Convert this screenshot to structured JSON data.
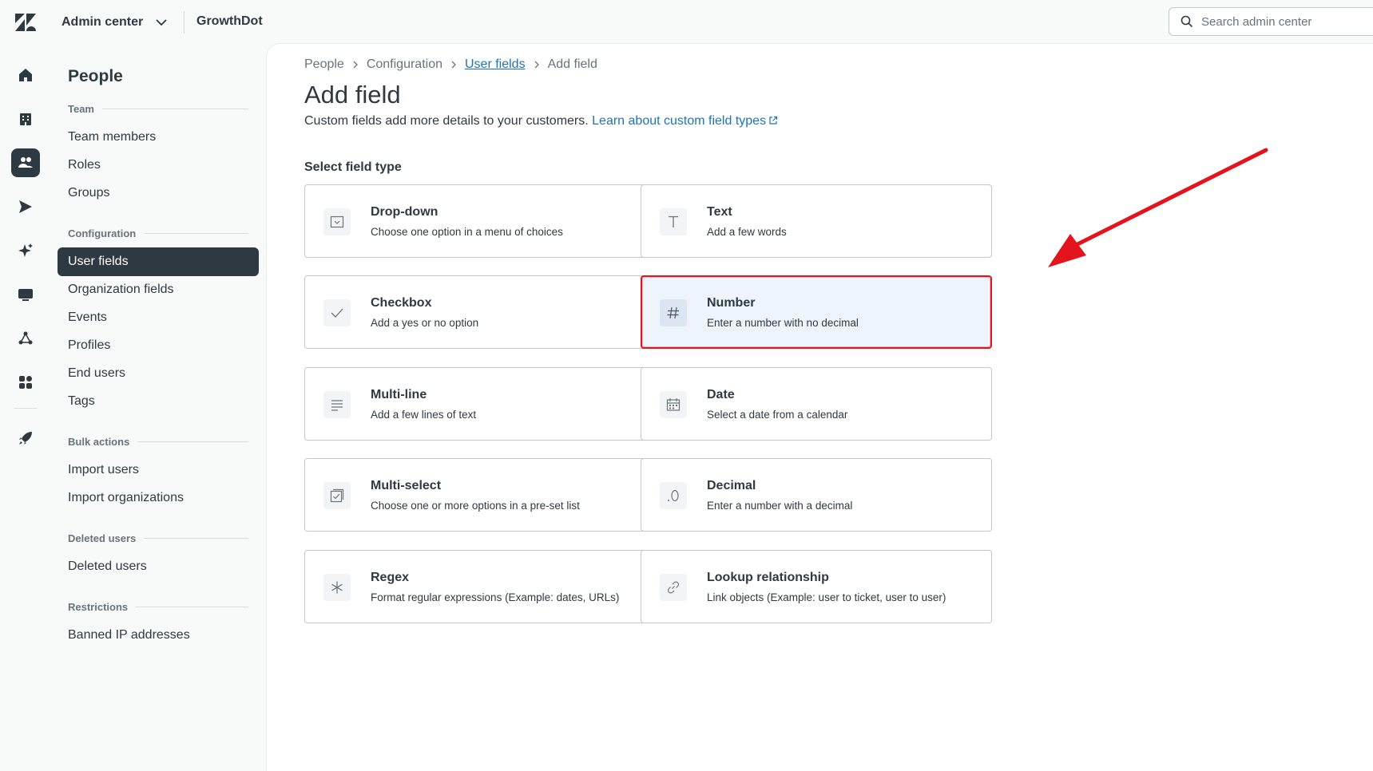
{
  "topbar": {
    "product_label": "Admin center",
    "account_name": "GrowthDot",
    "search_placeholder": "Search admin center"
  },
  "rail": {
    "items": [
      {
        "icon": "home-icon",
        "active": false
      },
      {
        "icon": "building-icon",
        "active": false
      },
      {
        "icon": "people-icon",
        "active": true
      },
      {
        "icon": "channels-icon",
        "active": false
      },
      {
        "icon": "sparkle-icon",
        "active": false
      },
      {
        "icon": "workspaces-icon",
        "active": false
      },
      {
        "icon": "objects-icon",
        "active": false
      },
      {
        "icon": "apps-icon",
        "active": false
      },
      {
        "icon": "rocket-icon",
        "active": false
      }
    ]
  },
  "subnav": {
    "title": "People",
    "sections": [
      {
        "label": "Team",
        "items": [
          "Team members",
          "Roles",
          "Groups"
        ]
      },
      {
        "label": "Configuration",
        "items": [
          "User fields",
          "Organization fields",
          "Events",
          "Profiles",
          "End users",
          "Tags"
        ]
      },
      {
        "label": "Bulk actions",
        "items": [
          "Import users",
          "Import organizations"
        ]
      },
      {
        "label": "Deleted users",
        "items": [
          "Deleted users"
        ]
      },
      {
        "label": "Restrictions",
        "items": [
          "Banned IP addresses"
        ]
      }
    ],
    "active_item": "User fields"
  },
  "breadcrumb": {
    "items": [
      {
        "label": "People",
        "link": false
      },
      {
        "label": "Configuration",
        "link": false
      },
      {
        "label": "User fields",
        "link": true
      },
      {
        "label": "Add field",
        "link": false
      }
    ]
  },
  "page": {
    "title": "Add field",
    "description": "Custom fields add more details to your customers.",
    "learn_link": "Learn about custom field types",
    "section_label": "Select field type"
  },
  "field_types": [
    {
      "title": "Drop-down",
      "desc": "Choose one option in a menu of choices",
      "icon": "dropdown-icon",
      "selected": false
    },
    {
      "title": "Text",
      "desc": "Add a few words",
      "icon": "text-icon",
      "selected": false
    },
    {
      "title": "Checkbox",
      "desc": "Add a yes or no option",
      "icon": "checkmark-icon",
      "selected": false
    },
    {
      "title": "Number",
      "desc": "Enter a number with no decimal",
      "icon": "hash-icon",
      "selected": true
    },
    {
      "title": "Multi-line",
      "desc": "Add a few lines of text",
      "icon": "lines-icon",
      "selected": false
    },
    {
      "title": "Date",
      "desc": "Select a date from a calendar",
      "icon": "calendar-icon",
      "selected": false
    },
    {
      "title": "Multi-select",
      "desc": "Choose one or more options in a pre-set list",
      "icon": "multiselect-icon",
      "selected": false
    },
    {
      "title": "Decimal",
      "desc": "Enter a number with a decimal",
      "icon": "decimal-icon",
      "selected": false
    },
    {
      "title": "Regex",
      "desc": "Format regular expressions (Example: dates, URLs)",
      "icon": "asterisk-icon",
      "selected": false
    },
    {
      "title": "Lookup relationship",
      "desc": "Link objects (Example: user to ticket, user to user)",
      "icon": "link-icon",
      "selected": false
    }
  ],
  "colors": {
    "highlight_border": "#e3141b",
    "selected_bg": "#edf4fb",
    "link": "#1f73b7",
    "nav_active_bg": "#2f3941"
  }
}
